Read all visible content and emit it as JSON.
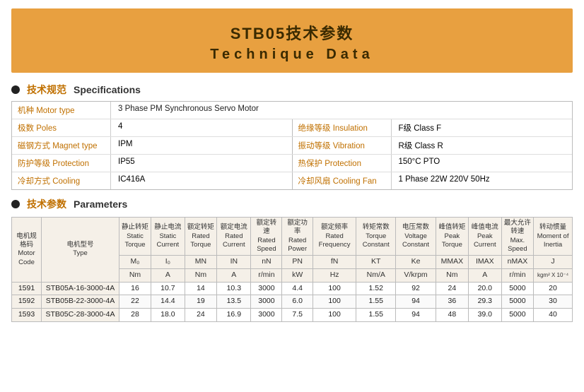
{
  "header": {
    "title_cn": "STB05技术参数",
    "title_en": "Technique Data"
  },
  "specs_section": {
    "label_cn": "技术规范",
    "label_en": "Specifications"
  },
  "params_section": {
    "label_cn": "技术参数",
    "label_en": "Parameters"
  },
  "specs": [
    {
      "label": "机种 Motor type",
      "value": "3 Phase PM Synchronous Servo Motor",
      "colspan": true
    },
    {
      "label": "极数 Poles",
      "value": "4",
      "label2": "绝缘等级 Insulation",
      "value2": "F级  Class F"
    },
    {
      "label": "磁钢方式 Magnet type",
      "value": "IPM",
      "label2": "振动等级 Vibration",
      "value2": "R级  Class R"
    },
    {
      "label": "防护等级 Protection",
      "value": "IP55",
      "label2": "热保护 Protection",
      "value2": "150°C PTO"
    },
    {
      "label": "冷却方式 Cooling",
      "value": "IC416A",
      "label2": "冷却风扇 Cooling Fan",
      "value2": "1 Phase  22W  220V  50Hz"
    }
  ],
  "params_headers": {
    "col1_cn": "静止转矩",
    "col1_en": "Static Torque",
    "col1_sub": "M₀",
    "col1_unit": "Nm",
    "col2_cn": "静止电流",
    "col2_en": "Static Current",
    "col2_sub": "I₀",
    "col2_unit": "A",
    "col3_cn": "额定转矩",
    "col3_en": "Rated Torque",
    "col3_sub": "MN",
    "col3_unit": "Nm",
    "col4_cn": "额定电流",
    "col4_en": "Rated Current",
    "col4_sub": "IN",
    "col4_unit": "A",
    "col5_cn": "额定转速",
    "col5_en": "Rated Speed",
    "col5_sub": "nN",
    "col5_unit": "r/min",
    "col6_cn": "额定功率",
    "col6_en": "Rated Power",
    "col6_sub": "PN",
    "col6_unit": "kW",
    "col7_cn": "额定频率",
    "col7_en": "Rated Frequency",
    "col7_sub": "fN",
    "col7_unit": "Hz",
    "col8_cn": "转矩常数",
    "col8_en": "Torque Constant",
    "col8_sub": "KT",
    "col8_unit": "Nm/A",
    "col9_cn": "电压常数",
    "col9_en": "Voltage Constant",
    "col9_sub": "Ke",
    "col9_unit": "V/krpm",
    "col10_cn": "峰值转矩",
    "col10_en": "Peak Torque",
    "col10_sub": "MMAX",
    "col10_unit": "Nm",
    "col11_cn": "峰值电流",
    "col11_en": "Peak Current",
    "col11_sub": "IMAX",
    "col11_unit": "A",
    "col12_cn": "最大允许转速",
    "col12_en": "Max. Speed",
    "col12_sub": "nMAX",
    "col12_unit": "r/min",
    "col13_cn": "转动惯量",
    "col13_en": "Moment of Inertia",
    "col13_sub": "J",
    "col13_unit": "kgm² X 10⁻⁴"
  },
  "motor_header": {
    "code_cn": "电机规格码",
    "code_en": "Motor Code",
    "type_cn": "电机型号",
    "type_en": "Type"
  },
  "rows": [
    {
      "code": "1591",
      "type": "STB05A-16-3000-4A",
      "v1": "16",
      "v2": "10.7",
      "v3": "14",
      "v4": "10.3",
      "v5": "3000",
      "v6": "4.4",
      "v7": "100",
      "v8": "1.52",
      "v9": "92",
      "v10": "24",
      "v11": "20.0",
      "v12": "5000",
      "v13": "20"
    },
    {
      "code": "1592",
      "type": "STB05B-22-3000-4A",
      "v1": "22",
      "v2": "14.4",
      "v3": "19",
      "v4": "13.5",
      "v5": "3000",
      "v6": "6.0",
      "v7": "100",
      "v8": "1.55",
      "v9": "94",
      "v10": "36",
      "v11": "29.3",
      "v12": "5000",
      "v13": "30"
    },
    {
      "code": "1593",
      "type": "STB05C-28-3000-4A",
      "v1": "28",
      "v2": "18.0",
      "v3": "24",
      "v4": "16.9",
      "v5": "3000",
      "v6": "7.5",
      "v7": "100",
      "v8": "1.55",
      "v9": "94",
      "v10": "48",
      "v11": "39.0",
      "v12": "5000",
      "v13": "40"
    }
  ]
}
